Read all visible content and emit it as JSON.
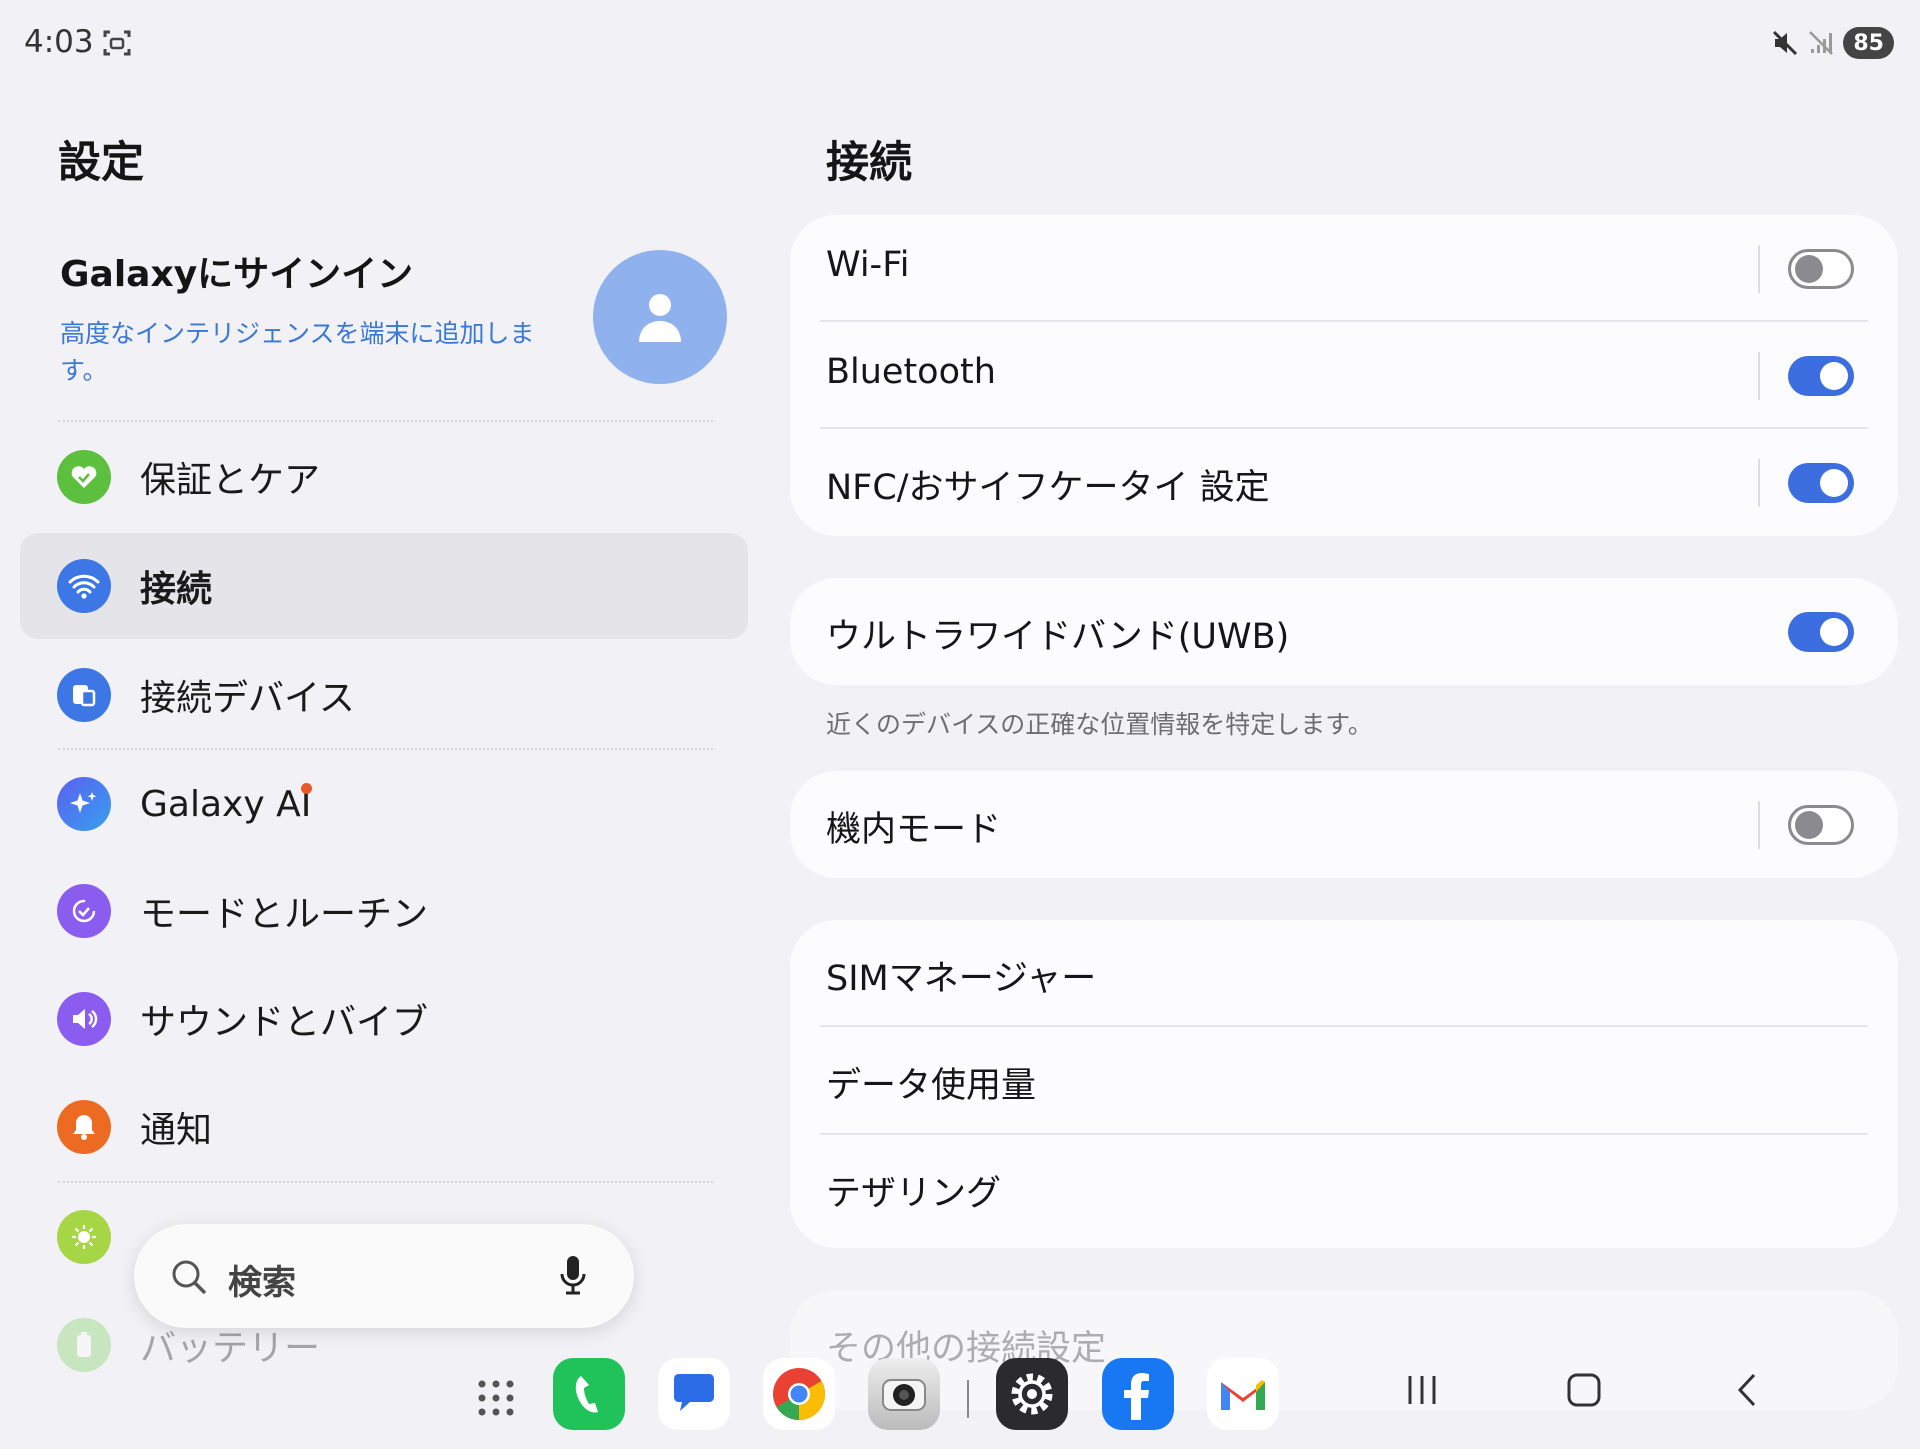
{
  "status_bar": {
    "time": "4:03",
    "battery": "85",
    "icons": [
      "screenshot-icon",
      "mute-icon",
      "no-signal-icon",
      "battery-icon"
    ]
  },
  "left": {
    "title": "設定",
    "signin": {
      "title": "Galaxyにサインイン",
      "subtitle": "高度なインテリジェンスを端末に追加します。"
    },
    "items": [
      {
        "label": "保証とケア",
        "icon": "heart-icon",
        "color": "#5cbf3d"
      },
      {
        "label": "接続",
        "icon": "wifi-icon",
        "color": "#3d77e6"
      },
      {
        "label": "接続デバイス",
        "icon": "devices-icon",
        "color": "#3d77e6"
      },
      {
        "label": "Galaxy AI",
        "icon": "sparkle-icon",
        "color": "#4a6cf0"
      },
      {
        "label": "モードとルーチン",
        "icon": "check-circle-icon",
        "color": "#8b5cf0"
      },
      {
        "label": "サウンドとバイブ",
        "icon": "speaker-icon",
        "color": "#8b5cf0"
      },
      {
        "label": "通知",
        "icon": "bell-icon",
        "color": "#ec6a22"
      },
      {
        "label": "バッテリー",
        "icon": "battery-icon",
        "color": "#7ccf5a"
      }
    ],
    "search": {
      "placeholder": "検索"
    }
  },
  "right": {
    "title": "接続",
    "group1": [
      {
        "label": "Wi-Fi",
        "on": false
      },
      {
        "label": "Bluetooth",
        "on": true
      },
      {
        "label": "NFC/おサイフケータイ 設定",
        "on": true
      }
    ],
    "uwb": {
      "label": "ウルトラワイドバンド(UWB)",
      "on": true,
      "note": "近くのデバイスの正確な位置情報を特定します。"
    },
    "airplane": {
      "label": "機内モード",
      "on": false
    },
    "group3": [
      "SIMマネージャー",
      "データ使用量",
      "テザリング"
    ],
    "more": "その他の接続設定"
  },
  "dock": {
    "apps": [
      "apps-grid-icon",
      "phone-icon",
      "messages-icon",
      "chrome-icon",
      "camera-icon",
      "settings-icon",
      "facebook-icon",
      "gmail-icon"
    ],
    "nav": [
      "recents-icon",
      "home-icon",
      "back-icon"
    ]
  },
  "colors": {
    "accent": "#3d6ee0",
    "background": "#f1f1f6",
    "card": "#fcfcfe",
    "link": "#3a78d8"
  }
}
